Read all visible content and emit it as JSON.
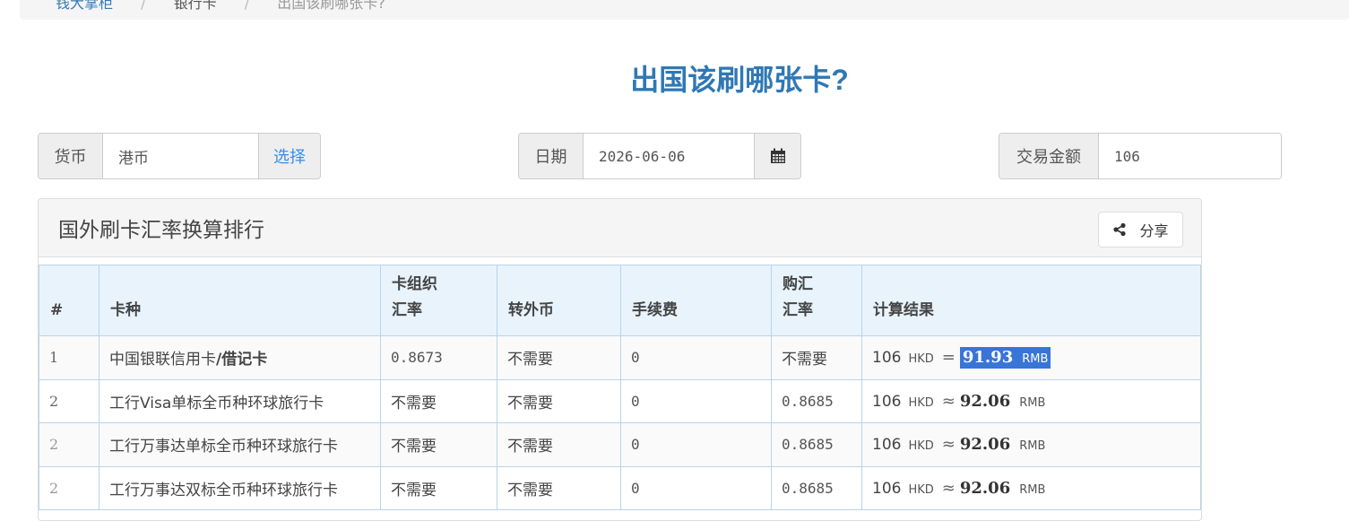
{
  "breadcrumb": {
    "items": [
      "钱大掌柜",
      "银行卡",
      "出国该刷哪张卡?"
    ]
  },
  "page_title": "出国该刷哪张卡?",
  "currency_group": {
    "label": "货币",
    "value": "港币",
    "button": "选择"
  },
  "date_group": {
    "label": "日期",
    "value": "2026-06-06",
    "icon": "calendar-icon"
  },
  "amount_group": {
    "label": "交易金额",
    "value": "106"
  },
  "panel": {
    "title": "国外刷卡汇率换算排行",
    "share_label": "分享",
    "share_icon": "share-icon"
  },
  "table": {
    "headers": {
      "rank": "#",
      "card": "卡种",
      "org_rate_1": "卡组织",
      "org_rate_2": "汇率",
      "convert": "转外币",
      "fee": "手续费",
      "buy_rate_1": "购汇",
      "buy_rate_2": "汇率",
      "result": "计算结果"
    },
    "rows": [
      {
        "rank": "1",
        "card_main": "中国银联信用卡",
        "card_bold": "/借记卡",
        "org_rate": "0.8673",
        "convert": "不需要",
        "fee": "0",
        "buy_rate": "不需要",
        "amount": "106",
        "from_cur": "HKD",
        "op": "=",
        "result": "91.93",
        "to_cur": "RMB"
      },
      {
        "rank": "2",
        "card_main": "工行Visa单标全币种环球旅行卡",
        "card_bold": "",
        "org_rate": "不需要",
        "convert": "不需要",
        "fee": "0",
        "buy_rate": "0.8685",
        "amount": "106",
        "from_cur": "HKD",
        "op": "≈",
        "result": "92.06",
        "to_cur": "RMB"
      },
      {
        "rank": "2",
        "card_main": "工行万事达单标全币种环球旅行卡",
        "card_bold": "",
        "org_rate": "不需要",
        "convert": "不需要",
        "fee": "0",
        "buy_rate": "0.8685",
        "amount": "106",
        "from_cur": "HKD",
        "op": "≈",
        "result": "92.06",
        "to_cur": "RMB"
      },
      {
        "rank": "2",
        "card_main": "工行万事达双标全币种环球旅行卡",
        "card_bold": "",
        "org_rate": "不需要",
        "convert": "不需要",
        "fee": "0",
        "buy_rate": "0.8685",
        "amount": "106",
        "from_cur": "HKD",
        "op": "≈",
        "result": "92.06",
        "to_cur": "RMB"
      }
    ]
  }
}
